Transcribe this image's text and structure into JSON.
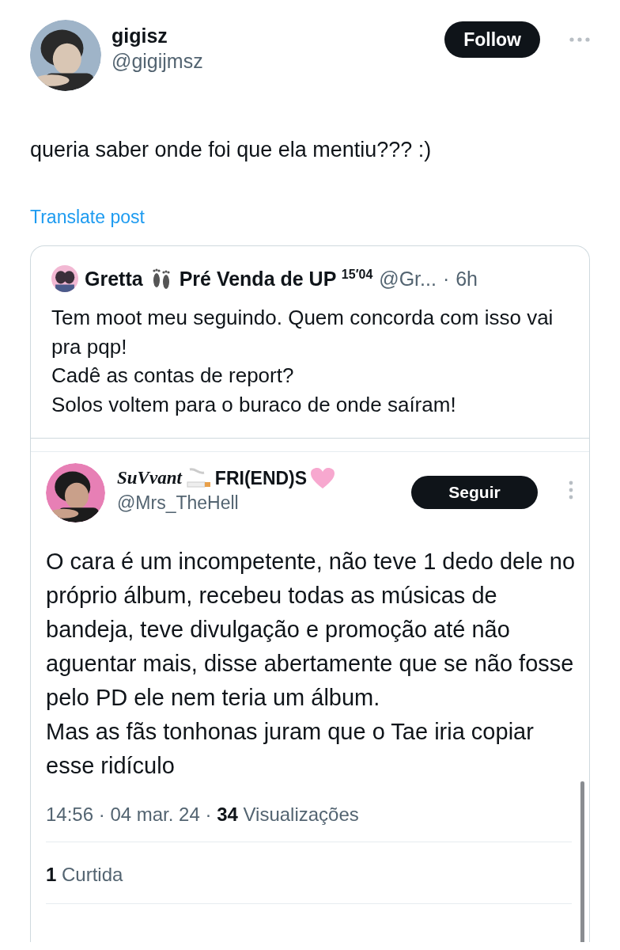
{
  "author": {
    "name": "gigisz",
    "handle": "@gigijmsz",
    "follow_button": "Follow"
  },
  "post_text": "queria saber onde foi que ela mentiu??? :)",
  "translate_link": "Translate post",
  "quoted_post": {
    "name_start": "Gretta",
    "name_end": "Pré Venda de UP $^{15′04}$",
    "handle": "@Gr...",
    "separator": "·",
    "time": "6h",
    "lines": [
      "Tem moot meu seguindo. Quem concorda com isso vai pra pqp!",
      "Cadê as contas de report?",
      "Solos voltem para o buraco de onde saíram!"
    ]
  },
  "embedded_post": {
    "name_script": "SuVvant",
    "name_rest": "FRI(END)S",
    "handle": "@Mrs_TheHell",
    "follow_button": "Seguir",
    "text": "O cara é um incompetente, não teve 1 dedo dele no próprio álbum, recebeu todas as músicas de bandeja, teve divulgação e promoção até não aguentar mais, disse abertamente que se não fosse pelo PD ele nem teria um álbum.\nMas as fãs tonhonas juram que o Tae iria copiar esse ridículo",
    "meta": "14:56 · 04 mar. 24 · **34** Visualizações",
    "likes": "**1** Curtida"
  }
}
